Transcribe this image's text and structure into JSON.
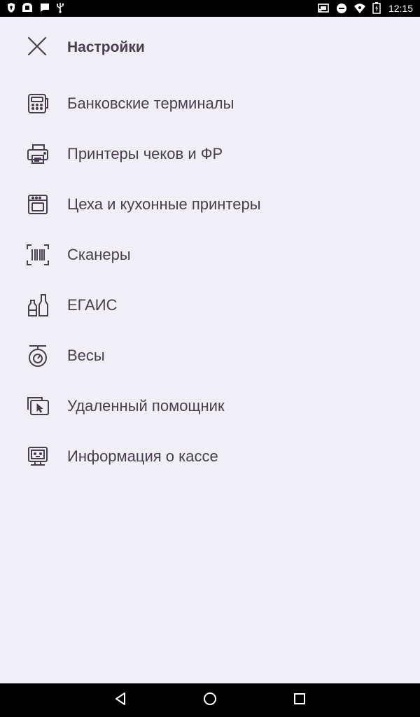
{
  "status_bar": {
    "time": "12:15",
    "left_icons": [
      "shield-icon",
      "ghost-icon",
      "chat-icon",
      "usb-icon"
    ],
    "right_icons": [
      "cast-icon",
      "do-not-disturb-icon",
      "wifi-icon",
      "battery-charging-icon"
    ]
  },
  "header": {
    "title": "Настройки",
    "close_icon": "close-icon"
  },
  "menu": {
    "items": [
      {
        "label": "Банковские терминалы",
        "icon": "pos-terminal-icon"
      },
      {
        "label": "Принтеры чеков и ФР",
        "icon": "printer-icon"
      },
      {
        "label": "Цеха и кухонные принтеры",
        "icon": "oven-icon"
      },
      {
        "label": "Сканеры",
        "icon": "barcode-scanner-icon"
      },
      {
        "label": "ЕГАИС",
        "icon": "bottles-icon"
      },
      {
        "label": "Весы",
        "icon": "scale-icon"
      },
      {
        "label": "Удаленный помощник",
        "icon": "remote-cursor-icon"
      },
      {
        "label": "Информация о кассе",
        "icon": "monitor-info-icon"
      }
    ]
  },
  "nav_bar": {
    "buttons": [
      "back-icon",
      "home-icon",
      "recents-icon"
    ]
  },
  "colors": {
    "background": "#f1eff6",
    "text": "#4a3d52",
    "icon": "#4a3d52",
    "bars": "#000000"
  }
}
